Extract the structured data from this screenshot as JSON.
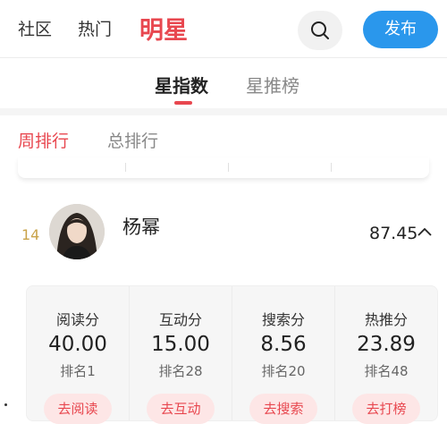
{
  "header": {
    "nav": [
      "社区",
      "热门",
      "明星"
    ],
    "publish_label": "发布"
  },
  "tabs": {
    "active": "星指数",
    "inactive": "星推榜"
  },
  "subtabs": {
    "week": "周排行",
    "total": "总排行"
  },
  "entry": {
    "rank": "14",
    "name": "杨幂",
    "score": "87.45"
  },
  "stats": [
    {
      "label": "阅读分",
      "value": "40.00",
      "rank": "排名1",
      "button": "去阅读"
    },
    {
      "label": "互动分",
      "value": "15.00",
      "rank": "排名28",
      "button": "去互动"
    },
    {
      "label": "搜索分",
      "value": "8.56",
      "rank": "排名20",
      "button": "去搜索"
    },
    {
      "label": "热推分",
      "value": "23.89",
      "rank": "排名48",
      "button": "去打榜"
    }
  ],
  "colors": {
    "accent": "#e8474f",
    "publish": "#2a97ec",
    "rank_gold": "#c9a34a"
  }
}
